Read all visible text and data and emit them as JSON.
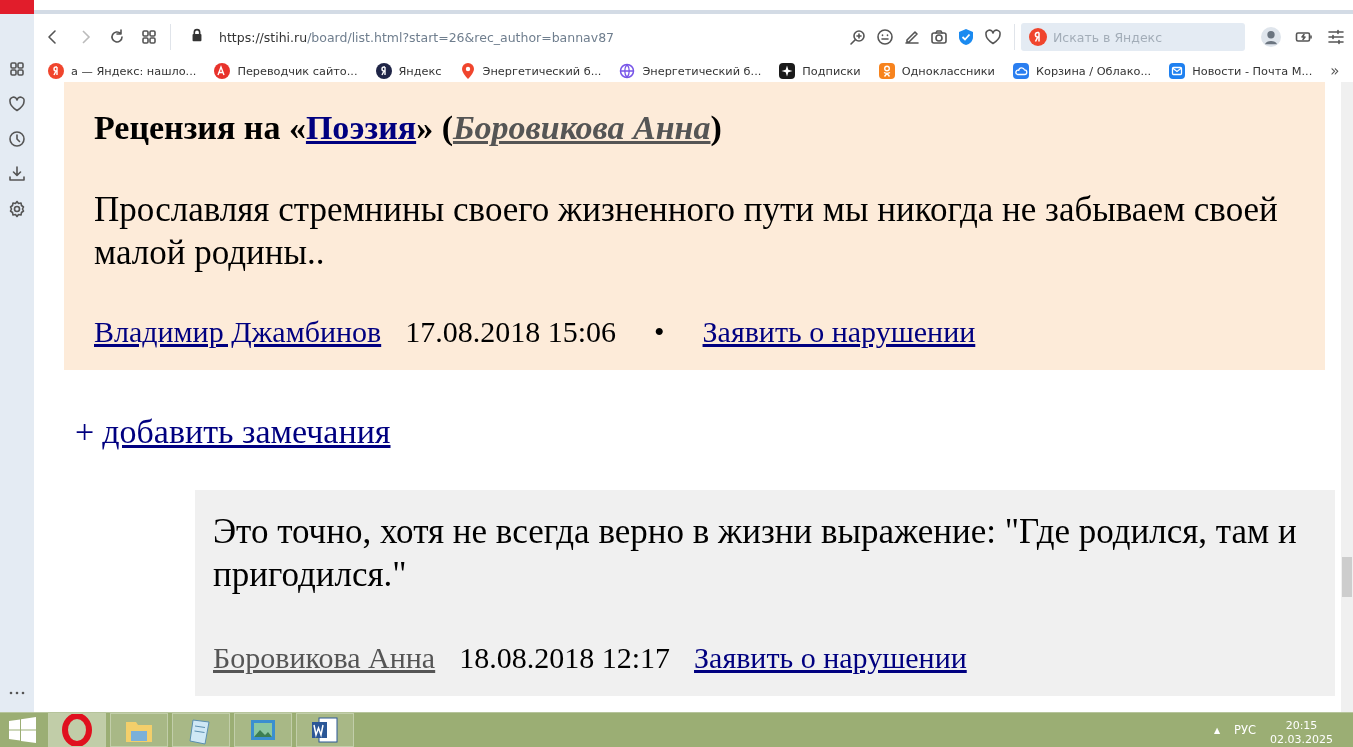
{
  "toolbar": {
    "url_host": "https://stihi.ru",
    "url_path": "/board/list.html?start=26&rec_author=bannav87",
    "search_placeholder": "Искать в Яндекс"
  },
  "bookmarks": [
    {
      "label": "а — Яндекс: нашло...",
      "kind": "yandex",
      "color": "#f0452d"
    },
    {
      "label": "Переводчик сайто...",
      "kind": "translate",
      "color": "#e8322b"
    },
    {
      "label": "Яндекс",
      "kind": "yandex",
      "color": "#1f2547"
    },
    {
      "label": "Энергетический б...",
      "kind": "pin",
      "color": "#f0452d"
    },
    {
      "label": "Энергетический б...",
      "kind": "globe",
      "color": "#7755e8"
    },
    {
      "label": "Подписки",
      "kind": "star",
      "color": "#1a1a1a"
    },
    {
      "label": "Одноклассники",
      "kind": "ok",
      "color": "#f7831d"
    },
    {
      "label": "Корзина / Облако...",
      "kind": "cloud",
      "color": "#2a7ef0"
    },
    {
      "label": "Новости - Почта М...",
      "kind": "mail",
      "color": "#1e80f0"
    }
  ],
  "bookmarks_more": "»",
  "review": {
    "heading_before": "Рецензия на «",
    "work": "Поэзия",
    "heading_middle": "» (",
    "author": "Боровикова Анна",
    "heading_after": ")",
    "text": "Прославляя стремнины своего жизненного пути мы никогда не забываем своей малой родины..",
    "reviewer": "Владимир Джамбинов",
    "datetime": "17.08.2018 15:06",
    "bullet": "•",
    "report": "Заявить о нарушении"
  },
  "add_comment": {
    "plus": "+",
    "label": "добавить замечания"
  },
  "reply": {
    "text": "Это точно, хотя не всегда верно в жизни выражение: \"Где родился, там и пригодился.\"",
    "author": "Боровикова Анна",
    "datetime": "18.08.2018 12:17",
    "report": "Заявить о нарушении"
  },
  "taskbar": {
    "apps": [
      {
        "kind": "opera",
        "selected": true
      },
      {
        "kind": "folder",
        "selected": false
      },
      {
        "kind": "notepad",
        "selected": false
      },
      {
        "kind": "photos",
        "selected": false
      },
      {
        "kind": "word",
        "selected": false
      }
    ],
    "tray_expand": "▲",
    "language": "РУС",
    "time": "20:15",
    "date": "02.03.2025"
  }
}
